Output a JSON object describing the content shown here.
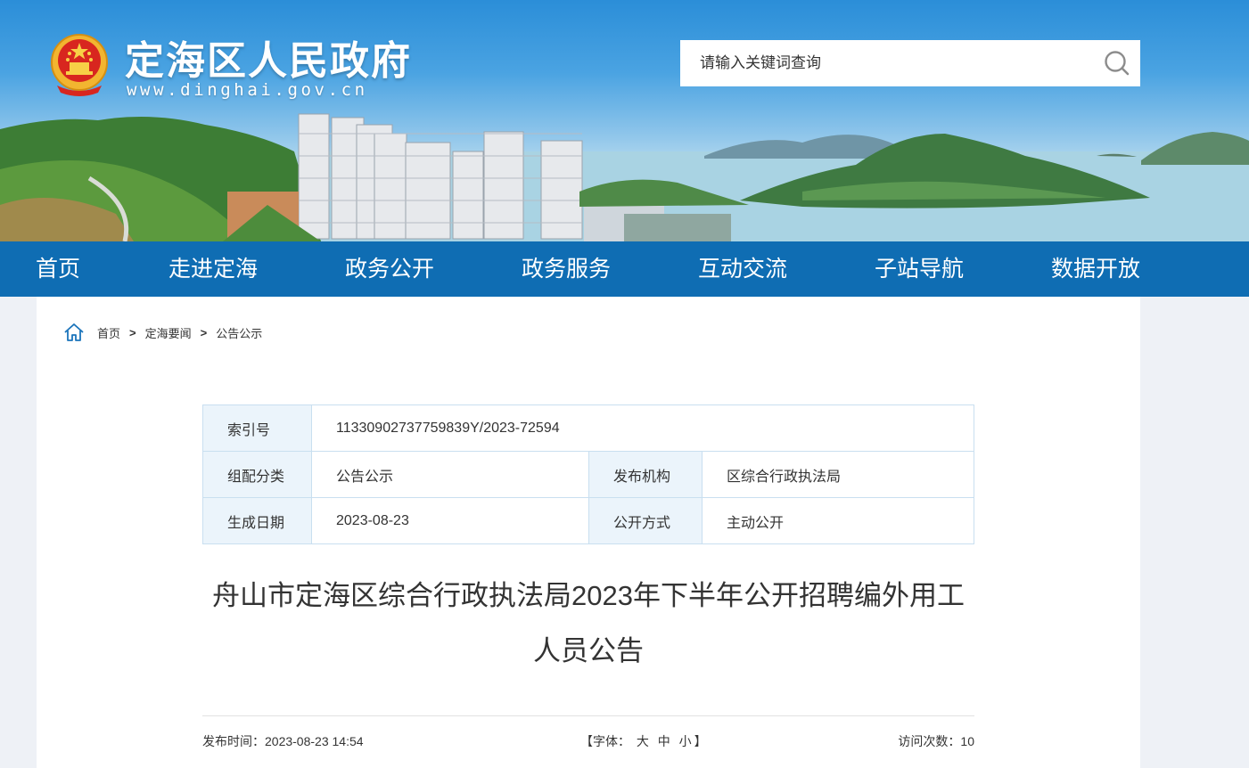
{
  "header": {
    "site_title": "定海区人民政府",
    "site_url": "www.dinghai.gov.cn",
    "search_placeholder": "请输入关键词查询"
  },
  "nav": {
    "items": [
      "首页",
      "走进定海",
      "政务公开",
      "政务服务",
      "互动交流",
      "子站导航",
      "数据开放"
    ]
  },
  "breadcrumb": {
    "items": [
      "首页",
      "定海要闻",
      "公告公示"
    ],
    "separator": ">"
  },
  "meta_table": {
    "index_label": "索引号",
    "index_value": "11330902737759839Y/2023-72594",
    "category_label": "组配分类",
    "category_value": "公告公示",
    "publisher_label": "发布机构",
    "publisher_value": "区综合行政执法局",
    "date_label": "生成日期",
    "date_value": "2023-08-23",
    "method_label": "公开方式",
    "method_value": "主动公开"
  },
  "article": {
    "title_line1": "舟山市定海区综合行政执法局2023年下半年公开招聘编外用工",
    "title_line2": "人员公告",
    "publish_label": "发布时间：",
    "publish_time": "2023-08-23 14:54",
    "font_open": "【字体：",
    "font_large": "大",
    "font_medium": "中",
    "font_small": "小",
    "font_close": "】",
    "visits_label": "访问次数：",
    "visits": "10"
  },
  "colors": {
    "nav_bg": "#0f6db3",
    "table_border": "#c9dff0",
    "table_label_bg": "#ebf4fb",
    "page_bg": "#eef1f6"
  }
}
